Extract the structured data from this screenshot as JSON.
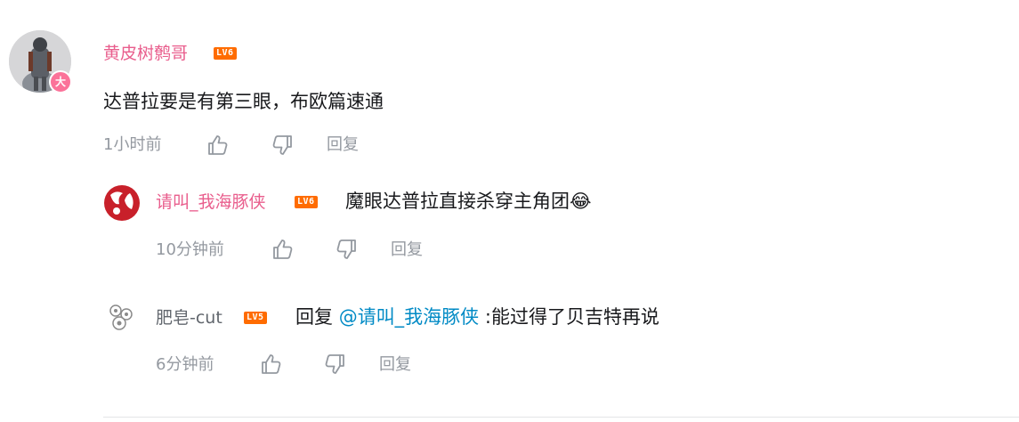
{
  "comment": {
    "username": "黄皮树鹩哥",
    "level": "LV6",
    "badge": "大",
    "content": "达普拉要是有第三眼，布欧篇速通",
    "time": "1小时前",
    "reply_label": "回复"
  },
  "replies": [
    {
      "username": "请叫_我海豚侠",
      "level": "LV6",
      "content": "魔眼达普拉直接杀穿主角团",
      "emoji": "😂",
      "time": "10分钟前",
      "reply_label": "回复"
    },
    {
      "username": "肥皂-cut",
      "level": "LV5",
      "prefix": "回复",
      "mention": "@请叫_我海豚侠",
      "content": " :能过得了贝吉特再说",
      "time": "6分钟前",
      "reply_label": "回复"
    }
  ],
  "colors": {
    "vip_name": "#e95e8d",
    "normal_name": "#61666d",
    "level_lv6": "#ff6c00",
    "level_lv5": "#ff6c00",
    "meta": "#9499a0",
    "mention": "#008ac5"
  }
}
